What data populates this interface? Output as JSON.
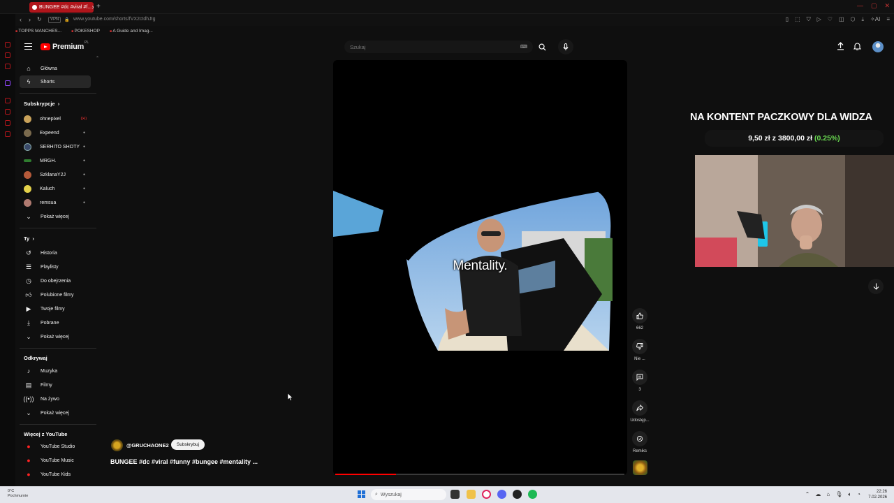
{
  "browser": {
    "tab_title": "BUNGEE #dc #viral #f...",
    "url": "www.youtube.com/shorts/fVX2ctdhJIg",
    "url_badge": "VPN",
    "bookmarks": [
      "TOPPS MANCHES...",
      "POKESHOP",
      "A Guide and Imag..."
    ]
  },
  "youtube": {
    "logo_text": "Premium",
    "logo_region": "PL",
    "search_placeholder": "Szukaj",
    "nav_main": [
      {
        "label": "Główna",
        "icon": "home-icon"
      },
      {
        "label": "Shorts",
        "icon": "shorts-icon",
        "active": true
      }
    ],
    "subscriptions_title": "Subskrypcje",
    "subscriptions": [
      {
        "label": "ohnepixel",
        "color": "#c9a25a",
        "badge": "live"
      },
      {
        "label": "Expeend",
        "color": "#7a6a4d",
        "badge": "dot"
      },
      {
        "label": "SERHITO SHOTY",
        "color": "#3a4a6a",
        "badge": "dot"
      },
      {
        "label": "MRGH.",
        "color": "#2f7d2f",
        "badge": "dot"
      },
      {
        "label": "SzklanaY2J",
        "color": "#b55a3a",
        "badge": "dot"
      },
      {
        "label": "Kaluch",
        "color": "#e3d14a",
        "badge": "dot"
      },
      {
        "label": "remsua",
        "color": "#b07a70",
        "badge": "dot"
      }
    ],
    "show_more": "Pokaż więcej",
    "you_title": "Ty",
    "you_items": [
      {
        "label": "Historia",
        "icon": "history-icon"
      },
      {
        "label": "Playlisty",
        "icon": "playlist-icon"
      },
      {
        "label": "Do obejrzenia",
        "icon": "watch-later-icon"
      },
      {
        "label": "Polubione filmy",
        "icon": "like-icon"
      },
      {
        "label": "Twoje filmy",
        "icon": "your-videos-icon"
      },
      {
        "label": "Pobrane",
        "icon": "download-icon"
      },
      {
        "label": "Pokaż więcej",
        "icon": "chevron-down-icon"
      }
    ],
    "explore_title": "Odkrywaj",
    "explore_items": [
      {
        "label": "Muzyka",
        "icon": "music-icon"
      },
      {
        "label": "Filmy",
        "icon": "film-icon"
      },
      {
        "label": "Na żywo",
        "icon": "live-icon"
      },
      {
        "label": "Pokaż więcej",
        "icon": "chevron-down-icon"
      }
    ],
    "more_title": "Więcej z YouTube",
    "more_items": [
      {
        "label": "YouTube Studio"
      },
      {
        "label": "YouTube Music"
      },
      {
        "label": "YouTube Kids"
      }
    ]
  },
  "short": {
    "caption": "Mentality.",
    "channel": "@GRUCHAONE2",
    "subscribe_label": "Subskrybuj",
    "title": "BUNGEE #dc #viral #funny #bungee #mentality ...",
    "progress": 0.21,
    "actions": {
      "like_count": "662",
      "dislike_label": "Nie ...",
      "comment_count": "3",
      "share_label": "Udostęp...",
      "remix_label": "Remiks"
    }
  },
  "stream_overlay": {
    "title": "NA KONTENT PACZKOWY DLA WIDZA",
    "donation_current": "9,50 zł",
    "donation_sep": "z",
    "donation_goal": "3800,00 zł",
    "donation_pct": "(0.25%)"
  },
  "taskbar": {
    "weather_temp": "0°C",
    "weather_desc": "Pochmurnie",
    "search_placeholder": "Wyszukaj",
    "time": "22:26",
    "date": "7.02.2026"
  }
}
